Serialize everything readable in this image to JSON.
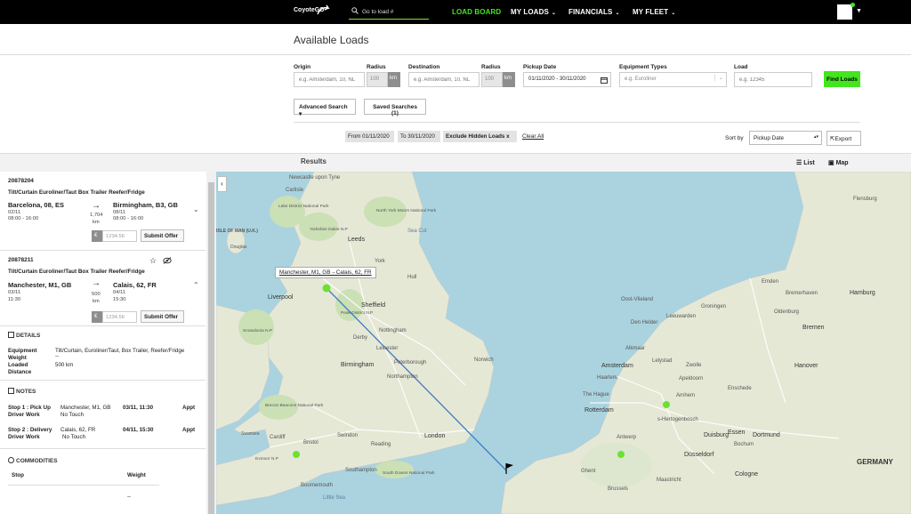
{
  "nav": {
    "logo": "CoyoteGO",
    "search_placeholder": "Go to load #",
    "items": [
      {
        "label": "LOAD BOARD",
        "active": true
      },
      {
        "label": "MY LOADS",
        "chevron": "⌄"
      },
      {
        "label": "FINANCIALS",
        "chevron": "⌄"
      },
      {
        "label": "MY FLEET",
        "chevron": "⌄"
      }
    ],
    "accent_color": "#44e51f"
  },
  "page": {
    "title": "Available Loads"
  },
  "form": {
    "origin_label": "Origin",
    "origin_placeholder": "e.g. Amsterdam, 10, NL",
    "radius_label": "Radius",
    "radius_value": "100",
    "radius_unit": "km",
    "destination_label": "Destination",
    "destination_placeholder": "e.g. Amsterdam, 10, NL",
    "radius2_label": "Radius",
    "radius2_value": "100",
    "radius2_unit": "km",
    "pickup_label": "Pickup Date",
    "pickup_value": "01/11/2020 - 30/11/2020",
    "equipment_label": "Equipment Types",
    "equipment_placeholder": "e.g. Euroliner",
    "load_label": "Load",
    "load_placeholder": "e.g. 12345",
    "find_button": "Find Loads",
    "advanced_button": "Advanced Search",
    "saved_button": "Saved Searches (1)"
  },
  "filters": {
    "chips": [
      {
        "text": "From 01/11/2020"
      },
      {
        "text": "To 30/11/2020"
      },
      {
        "text": "Exclude Hidden Loads",
        "close": "x"
      }
    ],
    "clear_all": "Clear All",
    "sort_label": "Sort by",
    "sort_value": "Pickup Date",
    "export_button": "Export"
  },
  "results": {
    "title": "Results",
    "list_tab": "List",
    "map_tab": "Map"
  },
  "loads": [
    {
      "id": "20878204",
      "equipment": "Tilt/Curtain Euroliner/Taut Box Trailer Reefer/Fridge",
      "origin": "Barcelona, 08, ES",
      "origin_date": "02/11",
      "origin_time": "08:00 - 16:00",
      "distance": "1,704",
      "distance_unit": "km",
      "dest": "Birmingham, B3, GB",
      "dest_date": "08/11",
      "dest_time": "08:00 - 16:00",
      "currency": "€",
      "price_placeholder": "1234.56",
      "submit": "Submit Offer"
    },
    {
      "id": "20878211",
      "equipment": "Tilt/Curtain Euroliner/Taut Box Trailer Reefer/Fridge",
      "origin": "Manchester, M1, GB",
      "origin_date": "03/11",
      "origin_time": "11:30",
      "distance": "500",
      "distance_unit": "km",
      "dest": "Calais, 62, FR",
      "dest_date": "04/11",
      "dest_time": "15:30",
      "currency": "€",
      "price_placeholder": "1234.56",
      "submit": "Submit Offer"
    }
  ],
  "details": {
    "title": "DETAILS",
    "equipment_key": "Equipment",
    "equipment_val": "Tilt/Curtain, Euroliner/Taut, Box Trailer, Reefer/Fridge",
    "weight_key": "Weight",
    "weight_val": "--",
    "loaded_key": "Loaded",
    "loaded_val": "500 km",
    "distance_key": "Distance"
  },
  "notes": {
    "title": "NOTES",
    "stop1_key": "Stop 1 : Pick Up",
    "stop1_loc": "Manchester, M1, GB",
    "stop1_time": "03/11, 11:30",
    "stop1_appt": "Appt",
    "stop1_work_key": "Driver Work",
    "stop1_work_val": "No Touch",
    "stop2_key": "Stop 2 : Delivery",
    "stop2_loc": "Calais, 62, FR",
    "stop2_time": "04/11, 15:30",
    "stop2_appt": "Appt",
    "stop2_work_key": "Driver Work",
    "stop2_work_val": "No Touch"
  },
  "commodities": {
    "title": "COMMODITIES",
    "col_stop": "Stop",
    "col_weight": "Weight",
    "weight_val": "--"
  },
  "map": {
    "route_label": "Manchester, M1, GB→Calais, 62, FR",
    "places": [
      "Newcastle upon Tyne",
      "Carlisle",
      "Lake District National Park",
      "North York Moors National Park",
      "Yorkshire Dales N.P",
      "ISLE OF MAN (U.K.)",
      "Douglas",
      "Leeds",
      "York",
      "Hull",
      "Liverpool",
      "Sheffield",
      "Peak District N.P",
      "Nottingham",
      "Derby",
      "Leicester",
      "Snowdonia N.P",
      "Birmingham",
      "Peterborough",
      "Norwich",
      "Northampton",
      "Brecon Beacons National Park",
      "Swansea",
      "Cardiff",
      "Bristol",
      "Swindon",
      "Reading",
      "London",
      "Exmoor N.P",
      "Southampton",
      "South Downs National Park",
      "Bournemouth",
      "Little Sea",
      "Sea Cut",
      "Flensburg",
      "Groningen",
      "Emden",
      "Bremerhaven",
      "Hamburg",
      "Oldenburg",
      "Bremen",
      "Den Helder",
      "Leeuwarden",
      "Oost-Vlieland",
      "Alkmaar",
      "Lelystad",
      "Zwolle",
      "Hanover",
      "Amsterdam",
      "Apeldoorn",
      "Haarlem",
      "The Hague",
      "Arnhem",
      "Rotterdam",
      "s-Hertogenbosch",
      "Duisburg",
      "Essen",
      "Dortmund",
      "Ghent",
      "Antwerp",
      "Düsseldorf",
      "Maastricht",
      "Brussels",
      "Cologne",
      "GERMANY",
      "Enschede",
      "Bochum"
    ]
  }
}
